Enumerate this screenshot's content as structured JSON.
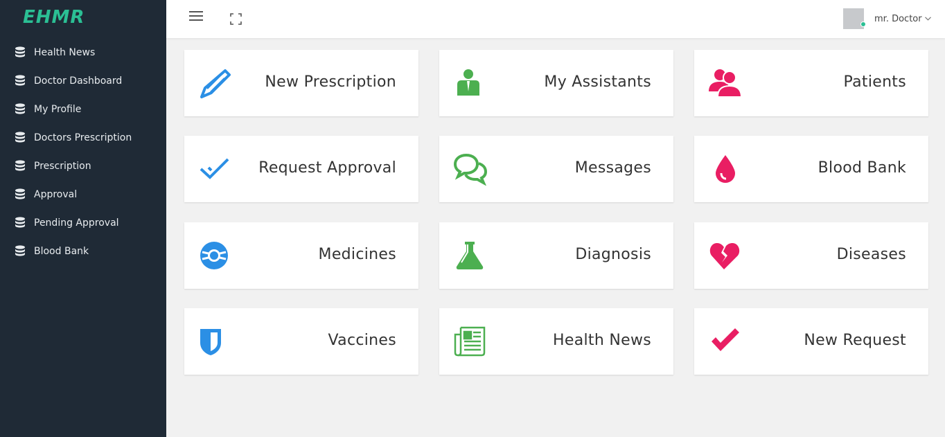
{
  "app": {
    "logo": "EHMR"
  },
  "sidebar": {
    "items": [
      {
        "label": "Health News",
        "icon": "database-icon"
      },
      {
        "label": "Doctor Dashboard",
        "icon": "database-icon"
      },
      {
        "label": "My Profile",
        "icon": "database-icon"
      },
      {
        "label": "Doctors Prescription",
        "icon": "database-icon"
      },
      {
        "label": "Prescription",
        "icon": "database-icon"
      },
      {
        "label": "Approval",
        "icon": "database-icon"
      },
      {
        "label": "Pending Approval",
        "icon": "database-icon"
      },
      {
        "label": "Blood Bank",
        "icon": "database-icon"
      }
    ]
  },
  "topbar": {
    "menu_icon": "hamburger-icon",
    "fullscreen_icon": "expand-icon",
    "user_name": "mr. Doctor",
    "user_status_color": "#2bbf94"
  },
  "cards": [
    {
      "label": "New Prescription",
      "icon": "pencil-icon",
      "color": "#2b8fe5"
    },
    {
      "label": "My Assistants",
      "icon": "user-tie-icon",
      "color": "#4caf50"
    },
    {
      "label": "Patients",
      "icon": "users-icon",
      "color": "#e91e63"
    },
    {
      "label": "Request Approval",
      "icon": "double-check-icon",
      "color": "#2b8fe5"
    },
    {
      "label": "Messages",
      "icon": "chat-bubbles-icon",
      "color": "#4caf50"
    },
    {
      "label": "Blood Bank",
      "icon": "blood-drop-icon",
      "color": "#e91e63"
    },
    {
      "label": "Medicines",
      "icon": "lifebuoy-icon",
      "color": "#2b8fe5"
    },
    {
      "label": "Diagnosis",
      "icon": "flask-icon",
      "color": "#4caf50"
    },
    {
      "label": "Diseases",
      "icon": "broken-heart-icon",
      "color": "#e91e63"
    },
    {
      "label": "Vaccines",
      "icon": "shield-icon",
      "color": "#2b8fe5"
    },
    {
      "label": "Health News",
      "icon": "newspaper-icon",
      "color": "#4caf50"
    },
    {
      "label": "New Request",
      "icon": "checkmark-icon",
      "color": "#e91e63"
    }
  ]
}
